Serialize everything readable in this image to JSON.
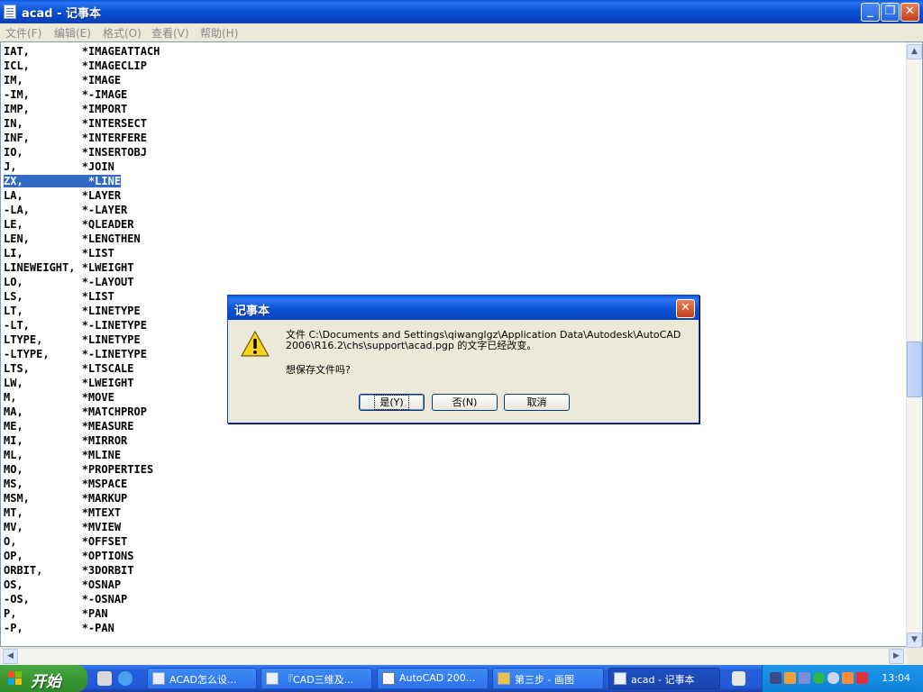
{
  "window": {
    "title": "acad - 记事本",
    "minimize": "_",
    "restore": "❐",
    "close": "✕"
  },
  "menu": [
    "文件(F)",
    "编辑(E)",
    "格式(O)",
    "查看(V)",
    "帮助(H)"
  ],
  "lines": [
    "IAT,        *IMAGEATTACH",
    "ICL,        *IMAGECLIP",
    "IM,         *IMAGE",
    "-IM,        *-IMAGE",
    "IMP,        *IMPORT",
    "IN,         *INTERSECT",
    "INF,        *INTERFERE",
    "IO,         *INSERTOBJ",
    "J,          *JOIN",
    "ZX,          *LINE",
    "LA,         *LAYER",
    "-LA,        *-LAYER",
    "LE,         *QLEADER",
    "LEN,        *LENGTHEN",
    "LI,         *LIST",
    "LINEWEIGHT, *LWEIGHT",
    "LO,         *-LAYOUT",
    "LS,         *LIST",
    "LT,         *LINETYPE",
    "-LT,        *-LINETYPE",
    "LTYPE,      *LINETYPE",
    "-LTYPE,     *-LINETYPE",
    "LTS,        *LTSCALE",
    "LW,         *LWEIGHT",
    "M,          *MOVE",
    "MA,         *MATCHPROP",
    "ME,         *MEASURE",
    "MI,         *MIRROR",
    "ML,         *MLINE",
    "MO,         *PROPERTIES",
    "MS,         *MSPACE",
    "MSM,        *MARKUP",
    "MT,         *MTEXT",
    "MV,         *MVIEW",
    "O,          *OFFSET",
    "OP,         *OPTIONS",
    "ORBIT,      *3DORBIT",
    "OS,         *OSNAP",
    "-OS,        *-OSNAP",
    "P,          *PAN",
    "-P,         *-PAN"
  ],
  "selected_line": "ZX,          *LINE",
  "dialog": {
    "title": "记事本",
    "close": "✕",
    "message_line1": "文件 C:\\Documents and Settings\\qiwanglgz\\Application Data\\Autodesk\\AutoCAD",
    "message_line2": "2006\\R16.2\\chs\\support\\acad.pgp 的文字已经改变。",
    "question": "想保存文件吗?",
    "yes": "是(Y)",
    "no": "否(N)",
    "cancel": "取消"
  },
  "taskbar": {
    "start": "开始",
    "tasks": [
      "ACAD怎么设...",
      "『CAD三维及...",
      "AutoCAD 200...",
      "第三步 - 画图",
      "acad - 记事本"
    ],
    "clock": "13:04"
  },
  "colors": {
    "selection": "#316ac5",
    "titlebar": "#0a54d8",
    "start": "#3c9b35",
    "tray": "#148de3"
  }
}
